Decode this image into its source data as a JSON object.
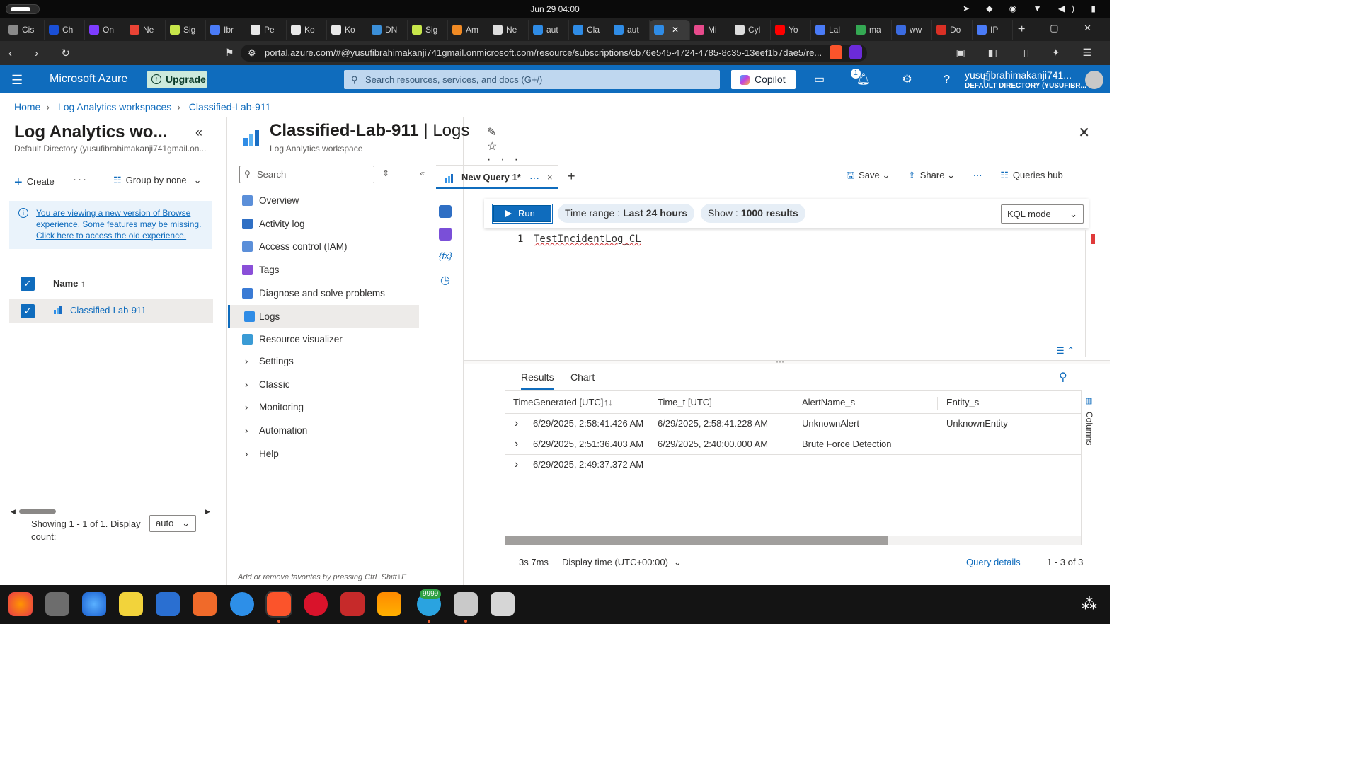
{
  "os": {
    "clock": "Jun 29  04:00"
  },
  "browser": {
    "tabs": [
      {
        "label": "Cis",
        "color": "#8a8a8a"
      },
      {
        "label": "Ch",
        "color": "#1a4fd6"
      },
      {
        "label": "On",
        "color": "#7d3cff"
      },
      {
        "label": "Ne",
        "color": "#ea4335"
      },
      {
        "label": "Sig",
        "color": "#c7e64a"
      },
      {
        "label": "Ibr",
        "color": "#4a7bf7"
      },
      {
        "label": "Pe",
        "color": "#e8e8e8"
      },
      {
        "label": "Ko",
        "color": "#e8e8e8"
      },
      {
        "label": "Ko",
        "color": "#e8e8e8"
      },
      {
        "label": "DN",
        "color": "#3b8fd8"
      },
      {
        "label": "Sig",
        "color": "#c7e64a"
      },
      {
        "label": "Am",
        "color": "#f08a24"
      },
      {
        "label": "Ne",
        "color": "#dddddd"
      },
      {
        "label": "aut",
        "color": "#2f8ce6"
      },
      {
        "label": "Cla",
        "color": "#2f8ce6"
      },
      {
        "label": "aut",
        "color": "#2f8ce6"
      },
      {
        "label": "",
        "color": "#2f8ce6",
        "active": true
      },
      {
        "label": "Mi",
        "color": "#e64a8b"
      },
      {
        "label": "Cyl",
        "color": "#dddddd"
      },
      {
        "label": "Yo",
        "color": "#ff0000"
      },
      {
        "label": "Lal",
        "color": "#4a7bf7"
      },
      {
        "label": "ma",
        "color": "#34a853"
      },
      {
        "label": "ww",
        "color": "#3b6be0"
      },
      {
        "label": "Do",
        "color": "#d93025"
      },
      {
        "label": "IP",
        "color": "#4a7bf7"
      }
    ],
    "url": "portal.azure.com/#@yusufibrahimakanji741gmail.onmicrosoft.com/resource/subscriptions/cb76e545-4724-4785-8c35-13eef1b7dae5/re..."
  },
  "azure": {
    "brand": "Microsoft Azure",
    "upgrade": "Upgrade",
    "search_placeholder": "Search resources, services, and docs (G+/)",
    "copilot": "Copilot",
    "notif_count": "1",
    "user_name": "yusufibrahimakanji741...",
    "user_dir": "DEFAULT DIRECTORY (YUSUFIBR..."
  },
  "breadcrumb": [
    "Home",
    "Log Analytics workspaces",
    "Classified-Lab-911"
  ],
  "left_pane": {
    "title": "Log Analytics wo...",
    "subtitle": "Default Directory (yusufibrahimakanji741gmail.on...",
    "create": "Create",
    "group_by": "Group by none",
    "info_text": "You are viewing a new version of Browse experience. Some features may be missing. Click here to access the old experience.",
    "col_name": "Name ↑",
    "row_name": "Classified-Lab-911",
    "showing": "Showing 1 - 1 of 1. Display count:",
    "display_count": "auto"
  },
  "resource": {
    "name": "Classified-Lab-911",
    "section": "| Logs",
    "type": "Log Analytics workspace"
  },
  "menu": {
    "search_placeholder": "Search",
    "items": [
      {
        "label": "Overview",
        "color": "#5b8fd9"
      },
      {
        "label": "Activity log",
        "color": "#2f6fc4"
      },
      {
        "label": "Access control (IAM)",
        "color": "#5b8fd9"
      },
      {
        "label": "Tags",
        "color": "#8a4fd8"
      },
      {
        "label": "Diagnose and solve problems",
        "color": "#3a7bd5"
      },
      {
        "label": "Logs",
        "color": "#2f8ce6"
      },
      {
        "label": "Resource visualizer",
        "color": "#3a9bd5"
      }
    ],
    "groups": [
      "Settings",
      "Classic",
      "Monitoring",
      "Automation",
      "Help"
    ],
    "favorites_tip": "Add or remove favorites by pressing Ctrl+Shift+F"
  },
  "query": {
    "tab_label": "New Query 1*",
    "save": "Save",
    "share": "Share",
    "queries_hub": "Queries hub",
    "run": "Run",
    "time_range_label": "Time range :",
    "time_range_value": "Last 24 hours",
    "show_label": "Show :",
    "show_value": "1000 results",
    "mode": "KQL mode",
    "line_number": "1",
    "code": "TestIncidentLog_CL"
  },
  "results": {
    "tabs": [
      "Results",
      "Chart"
    ],
    "columns": [
      "TimeGenerated [UTC]",
      "Time_t [UTC]",
      "AlertName_s",
      "Entity_s"
    ],
    "rows": [
      [
        "6/29/2025, 2:58:41.426 AM",
        "6/29/2025, 2:58:41.228 AM",
        "UnknownAlert",
        "UnknownEntity"
      ],
      [
        "6/29/2025, 2:51:36.403 AM",
        "6/29/2025, 2:40:00.000 AM",
        "Brute Force Detection",
        ""
      ],
      [
        "6/29/2025, 2:49:37.372 AM",
        "",
        "",
        ""
      ]
    ],
    "columns_side": "Columns",
    "duration": "3s 7ms",
    "display_time": "Display time (UTC+00:00)",
    "query_details": "Query details",
    "count": "1 - 3 of 3"
  },
  "taskbar": {
    "telegram_badge": "9999"
  }
}
